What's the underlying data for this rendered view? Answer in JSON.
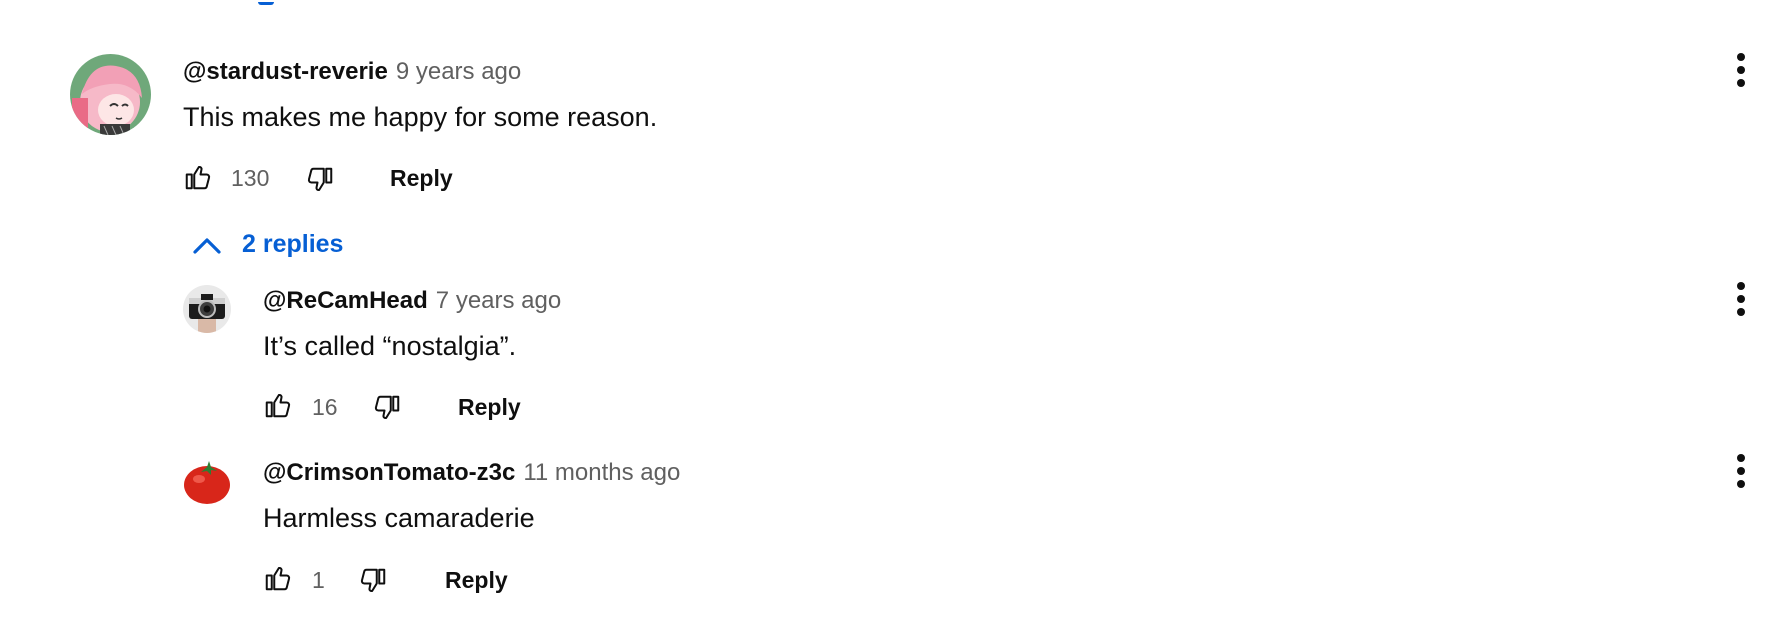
{
  "comments": [
    {
      "author": "@stardust-reverie",
      "time": "9 years ago",
      "text": "This makes me happy for some reason.",
      "likes": "130",
      "reply_label": "Reply",
      "avatar_icon": "anime-girl-avatar"
    }
  ],
  "replies_toggle": {
    "label": "2 replies",
    "icon": "chevron-up-icon",
    "color": "#065fd4"
  },
  "replies": [
    {
      "author": "@ReCamHead",
      "time": "7 years ago",
      "text": "It’s called “nostalgia”.",
      "likes": "16",
      "reply_label": "Reply",
      "avatar_icon": "camera-avatar"
    },
    {
      "author": "@CrimsonTomato-z3c",
      "time": "11 months ago",
      "text": "Harmless camaraderie",
      "likes": "1",
      "reply_label": "Reply",
      "avatar_icon": "tomato-avatar"
    }
  ],
  "colors": {
    "text": "#0f0f0f",
    "secondary": "#606060",
    "link": "#065fd4"
  }
}
